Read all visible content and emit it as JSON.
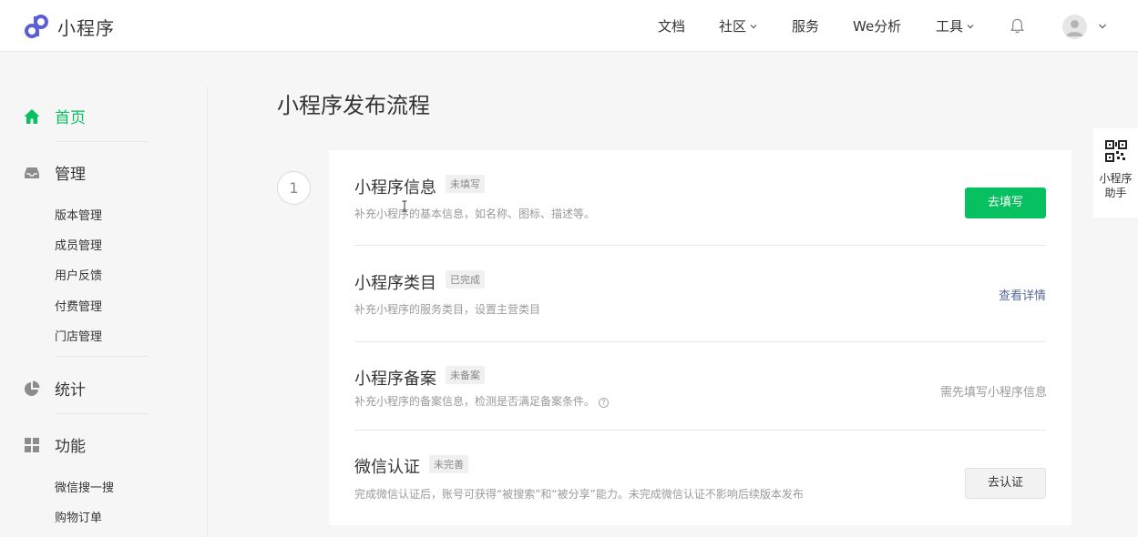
{
  "brand": {
    "name": "小程序",
    "accent": "#5a5fd6"
  },
  "nav": {
    "items": [
      {
        "label": "文档",
        "has_dropdown": false
      },
      {
        "label": "社区",
        "has_dropdown": true
      },
      {
        "label": "服务",
        "has_dropdown": false
      },
      {
        "label": "We分析",
        "has_dropdown": false
      },
      {
        "label": "工具",
        "has_dropdown": true
      }
    ],
    "icons": [
      "bell-icon",
      "avatar",
      "chevron-down-icon"
    ]
  },
  "sidebar": {
    "home": {
      "label": "首页",
      "icon": "home-icon"
    },
    "manage": {
      "label": "管理",
      "icon": "inbox-icon",
      "items": [
        "版本管理",
        "成员管理",
        "用户反馈",
        "付费管理",
        "门店管理"
      ]
    },
    "stats": {
      "label": "统计",
      "icon": "pie-chart-icon"
    },
    "features": {
      "label": "功能",
      "icon": "grid-icon",
      "items": [
        "微信搜一搜",
        "购物订单"
      ]
    }
  },
  "main": {
    "title": "小程序发布流程",
    "step_number": "1",
    "steps": [
      {
        "title": "小程序信息",
        "tag": "未填写",
        "desc": "补充小程序的基本信息，如名称、图标、描述等。",
        "action": {
          "type": "primary-button",
          "label": "去填写"
        }
      },
      {
        "title": "小程序类目",
        "tag": "已完成",
        "desc": "补充小程序的服务类目，设置主营类目",
        "action": {
          "type": "link",
          "label": "查看详情"
        }
      },
      {
        "title": "小程序备案",
        "tag": "未备案",
        "desc": "补充小程序的备案信息，检测是否满足备案条件。",
        "help": "?",
        "action": {
          "type": "text",
          "label": "需先填写小程序信息"
        }
      },
      {
        "title": "微信认证",
        "tag": "未完善",
        "desc": "完成微信认证后，账号可获得“被搜索”和“被分享”能力。未完成微信认证不影响后续版本发布",
        "action": {
          "type": "default-button",
          "label": "去认证"
        }
      }
    ]
  },
  "assistant": {
    "label": "小程序助手",
    "icon": "qr-code-icon"
  },
  "colors": {
    "primary": "#07c160",
    "link": "#576b95",
    "text": "#353535",
    "muted": "#9a9a9a",
    "background": "#f6f6f6"
  }
}
